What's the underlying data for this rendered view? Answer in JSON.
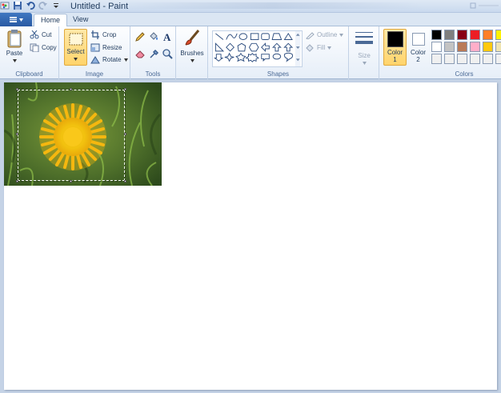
{
  "window": {
    "title": "Untitled - Paint"
  },
  "tabs": [
    {
      "label": "Home"
    },
    {
      "label": "View"
    }
  ],
  "clipboard": {
    "paste": "Paste",
    "cut": "Cut",
    "copy": "Copy",
    "group": "Clipboard"
  },
  "image": {
    "select": "Select",
    "crop": "Crop",
    "resize": "Resize",
    "rotate": "Rotate",
    "group": "Image"
  },
  "tools": {
    "group": "Tools"
  },
  "brushes": {
    "label": "Brushes"
  },
  "shapes": {
    "outline": "Outline",
    "fill": "Fill",
    "group": "Shapes"
  },
  "size": {
    "label": "Size"
  },
  "colors": {
    "color1": "Color",
    "color1_num": "1",
    "color2": "Color",
    "color2_num": "2",
    "group": "Colors",
    "color1_value": "#000000",
    "color2_value": "#ffffff",
    "palette_row1": [
      "#000000",
      "#7f7f7f",
      "#880015",
      "#ed1c24",
      "#ff7f27",
      "#fff200"
    ],
    "palette_row2": [
      "#ffffff",
      "#c3c3c3",
      "#b97a57",
      "#ffaec9",
      "#ffc90e",
      "#efe4b0"
    ],
    "palette_row3": [
      "#f0f0f0",
      "#f0f0f0",
      "#f0f0f0",
      "#f0f0f0",
      "#f0f0f0",
      "#f0f0f0"
    ]
  },
  "accent": "#ffd46b"
}
